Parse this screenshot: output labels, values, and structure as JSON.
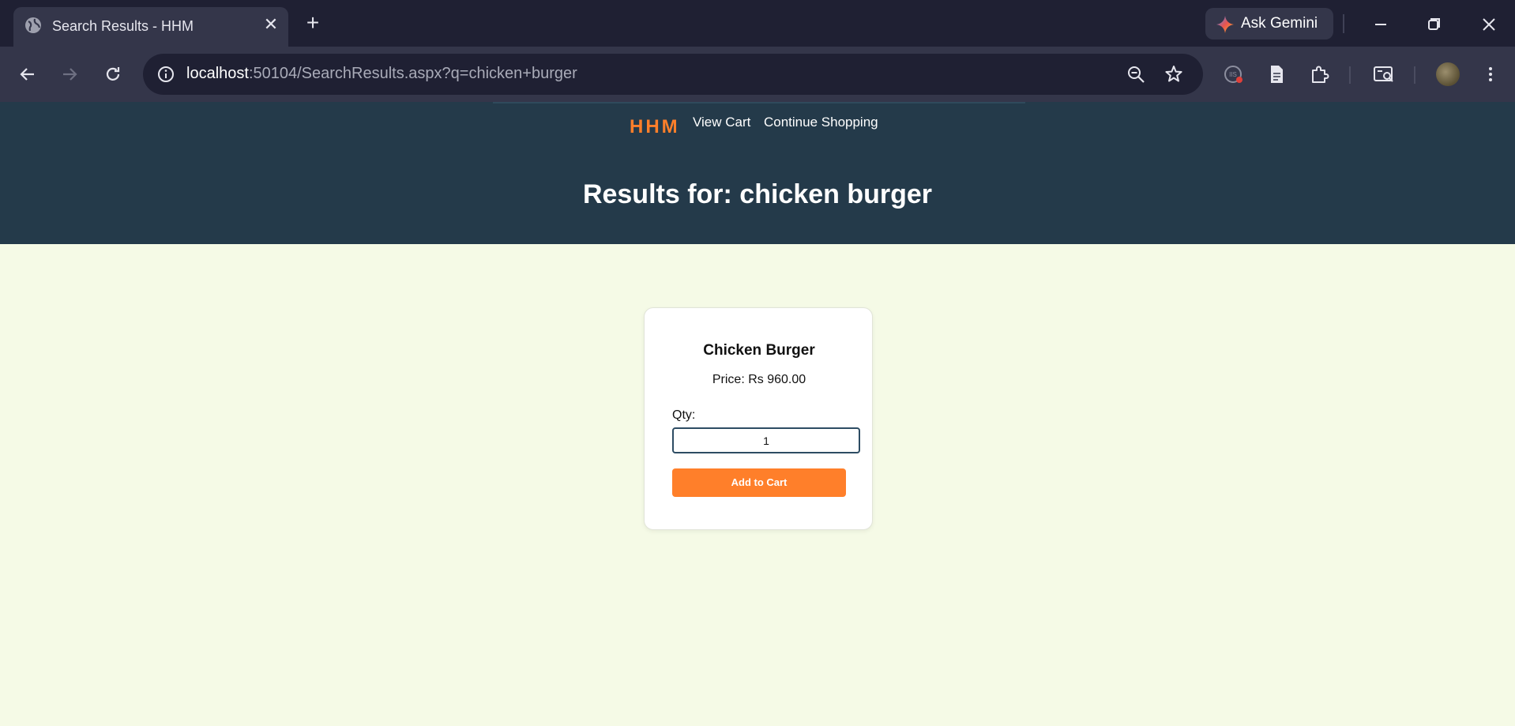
{
  "browser": {
    "tab_title": "Search Results - HHM",
    "tab_close_glyph": "✕",
    "new_tab_glyph": "+",
    "gemini_label": "Ask Gemini",
    "url_host": "localhost",
    "url_rest": ":50104/SearchResults.aspx?q=chicken+burger",
    "icons": [
      "globe-icon",
      "close-icon",
      "plus-icon",
      "gemini-icon",
      "minimize-icon",
      "restore-icon",
      "close-window-icon",
      "back-icon",
      "forward-icon",
      "reload-icon",
      "info-icon",
      "zoom-out-icon",
      "star-icon",
      "extension-badge-icon",
      "document-icon",
      "puzzle-icon",
      "reading-list-icon",
      "profile-avatar"
    ]
  },
  "site": {
    "brand": "HHM",
    "nav": {
      "view_cart": "View Cart",
      "continue_shopping": "Continue Shopping"
    },
    "results_title": "Results for: chicken burger"
  },
  "product": {
    "name": "Chicken Burger",
    "price": "Price: Rs 960.00",
    "qty_label": "Qty:",
    "qty_value": "1",
    "add_button": "Add to Cart"
  },
  "colors": {
    "brand": "#ff7f2a",
    "header_bg": "#243a4a",
    "page_bg": "#f5fae6",
    "button_bg": "#ff7f2a"
  }
}
